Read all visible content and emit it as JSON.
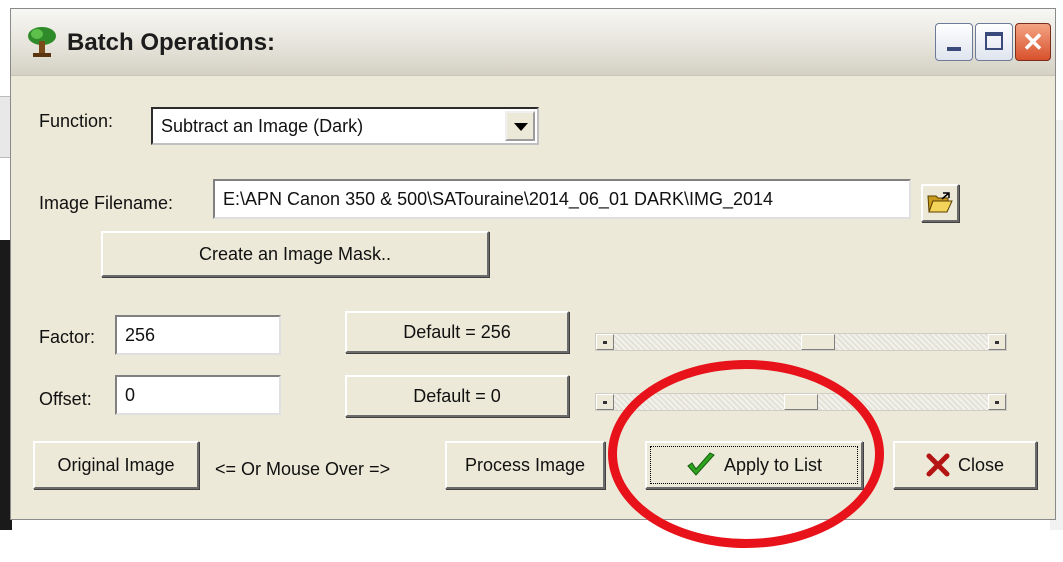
{
  "window": {
    "title": "Batch Operations:",
    "icon": "tree-app-icon",
    "controls": [
      "minimize-icon",
      "maximize-icon",
      "close-icon"
    ]
  },
  "function_row": {
    "label": "Function:",
    "selected": "Subtract an Image (Dark)"
  },
  "filename_row": {
    "label": "Image Filename:",
    "value": "E:\\APN Canon 350 & 500\\SATouraine\\2014_06_01 DARK\\IMG_2014",
    "browse_icon": "open-folder-icon"
  },
  "mask_button": "Create an Image Mask..",
  "factor": {
    "label": "Factor:",
    "value": "256",
    "default_button": "Default = 256",
    "slider_level": 0.55
  },
  "offset": {
    "label": "Offset:",
    "value": "0",
    "default_button": "Default = 0",
    "slider_level": 0.5
  },
  "bottom": {
    "original_button": "Original Image",
    "hint": "<= Or Mouse Over =>",
    "process_button": "Process Image",
    "apply_button": "Apply to List",
    "apply_icon": "checkmark-icon",
    "close_button": "Close",
    "close_icon": "red-x-icon"
  },
  "colors": {
    "annotation": "#e8121a",
    "window_face": "#ece9d8"
  }
}
